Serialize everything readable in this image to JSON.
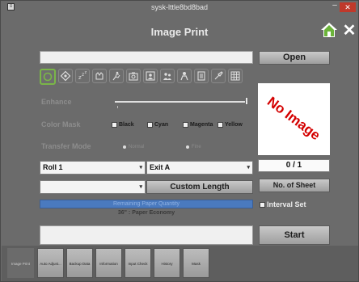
{
  "titlebar": {
    "title": "sysk-lttle8bd8bad",
    "app_icon": "window-icon",
    "min_label": "–",
    "close_label": "✕"
  },
  "header": {
    "title": "Image Print",
    "home_icon": "home-icon",
    "exit_icon": "close-icon",
    "exit_label": "✕"
  },
  "file": {
    "path_value": "",
    "open_label": "Open"
  },
  "modes": {
    "icons": [
      "mode-auto-icon",
      "mode-diamond-icon",
      "mode-sleep-icon",
      "mode-pets-icon",
      "mode-sport-icon",
      "mode-camera-icon",
      "mode-portrait-icon",
      "mode-group-icon",
      "mode-person-icon",
      "mode-document-icon",
      "mode-brush-icon",
      "mode-grid-icon"
    ],
    "selected_index": 0,
    "accent": "#7ab648"
  },
  "enhance": {
    "label": "Enhance",
    "level": 1.0
  },
  "color_mask": {
    "label": "Color Mask",
    "options": [
      "Black",
      "Cyan",
      "Magenta",
      "Yellow"
    ]
  },
  "transfer_mode": {
    "label": "Transfer Mode",
    "options": [
      "Normal",
      "Fine"
    ]
  },
  "preview": {
    "text": "No Image",
    "color": "#d40000"
  },
  "selects": {
    "roll": "Roll 1",
    "exit": "Exit A",
    "size": ""
  },
  "counter": {
    "value": "0 / 1"
  },
  "buttons": {
    "custom_length": "Custom Length",
    "no_of_sheet": "No. of Sheet",
    "start": "Start"
  },
  "interval": {
    "label": "Interval Set"
  },
  "paper": {
    "remaining_label": "Remaining Paper Quantity",
    "economy": "36\" : Paper Economy",
    "fill_color": "#4a7abf"
  },
  "message": {
    "value": ""
  },
  "tabs": [
    "Image Print",
    "Auto Adjust...",
    "Backup Data",
    "Information",
    "Input Check",
    "History",
    "Mask"
  ]
}
